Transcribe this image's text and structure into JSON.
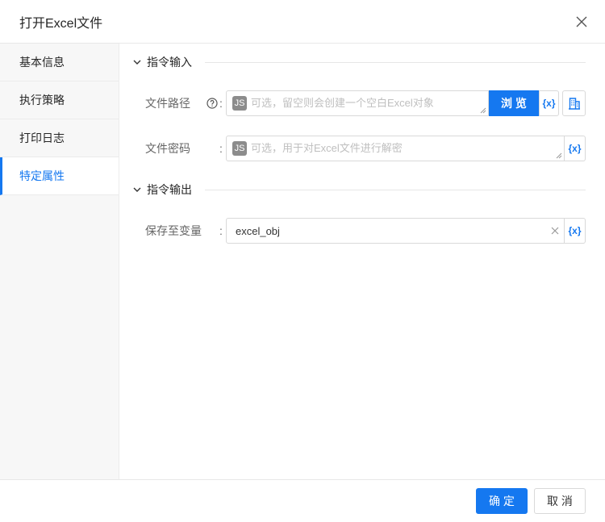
{
  "dialog": {
    "title": "打开Excel文件"
  },
  "sidebar": {
    "items": [
      {
        "label": "基本信息",
        "selected": false
      },
      {
        "label": "执行策略",
        "selected": false
      },
      {
        "label": "打印日志",
        "selected": false
      },
      {
        "label": "特定属性",
        "selected": true
      }
    ]
  },
  "sections": {
    "input": {
      "title": "指令输入",
      "fields": {
        "file_path": {
          "label": "文件路径",
          "colon": ":",
          "badge": "JS",
          "placeholder": "可选，留空则会创建一个空白Excel对象",
          "browse_label": "浏 览",
          "var_label": "{x}"
        },
        "file_password": {
          "label": "文件密码",
          "colon": ":",
          "badge": "JS",
          "placeholder": "可选，用于对Excel文件进行解密",
          "var_label": "{x}"
        }
      }
    },
    "output": {
      "title": "指令输出",
      "fields": {
        "save_to": {
          "label": "保存至变量",
          "colon": ":",
          "value": "excel_obj",
          "var_label": "{x}"
        }
      }
    }
  },
  "footer": {
    "confirm_label": "确 定",
    "cancel_label": "取 消"
  },
  "colors": {
    "primary": "#1578f0",
    "sidebar_bg": "#f7f7f7",
    "badge_bg": "#8c8c8c",
    "border": "#d9d9d9"
  },
  "icons": [
    "close-icon",
    "chevron-down-icon",
    "help-icon",
    "resize-grip-icon",
    "building-icon",
    "clear-icon"
  ]
}
